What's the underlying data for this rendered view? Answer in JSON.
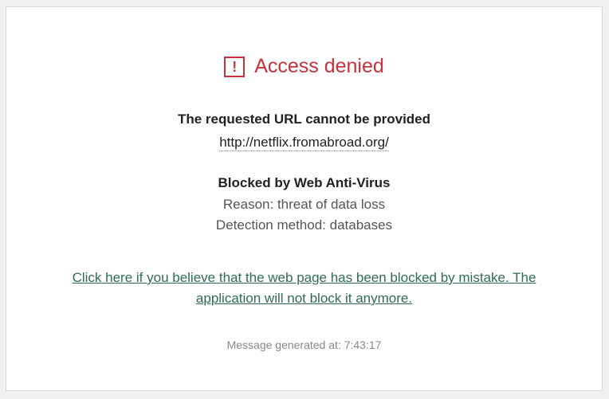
{
  "page": {
    "title": "Access denied",
    "subtitle": "The requested URL cannot be provided",
    "url": "http://netflix.fromabroad.org/",
    "blocked_by": "Blocked by Web Anti-Virus",
    "reason": "Reason: threat of data loss",
    "detection_method": "Detection method: databases",
    "mistake_link": "Click here if you believe that the web page has been blocked by mistake. The application will not block it anymore.",
    "generated_at": "Message generated at: 7:43:17"
  },
  "icons": {
    "alert": "exclamation-box-icon"
  },
  "colors": {
    "accent_red": "#c8323c",
    "link_green": "#2f6b57"
  }
}
